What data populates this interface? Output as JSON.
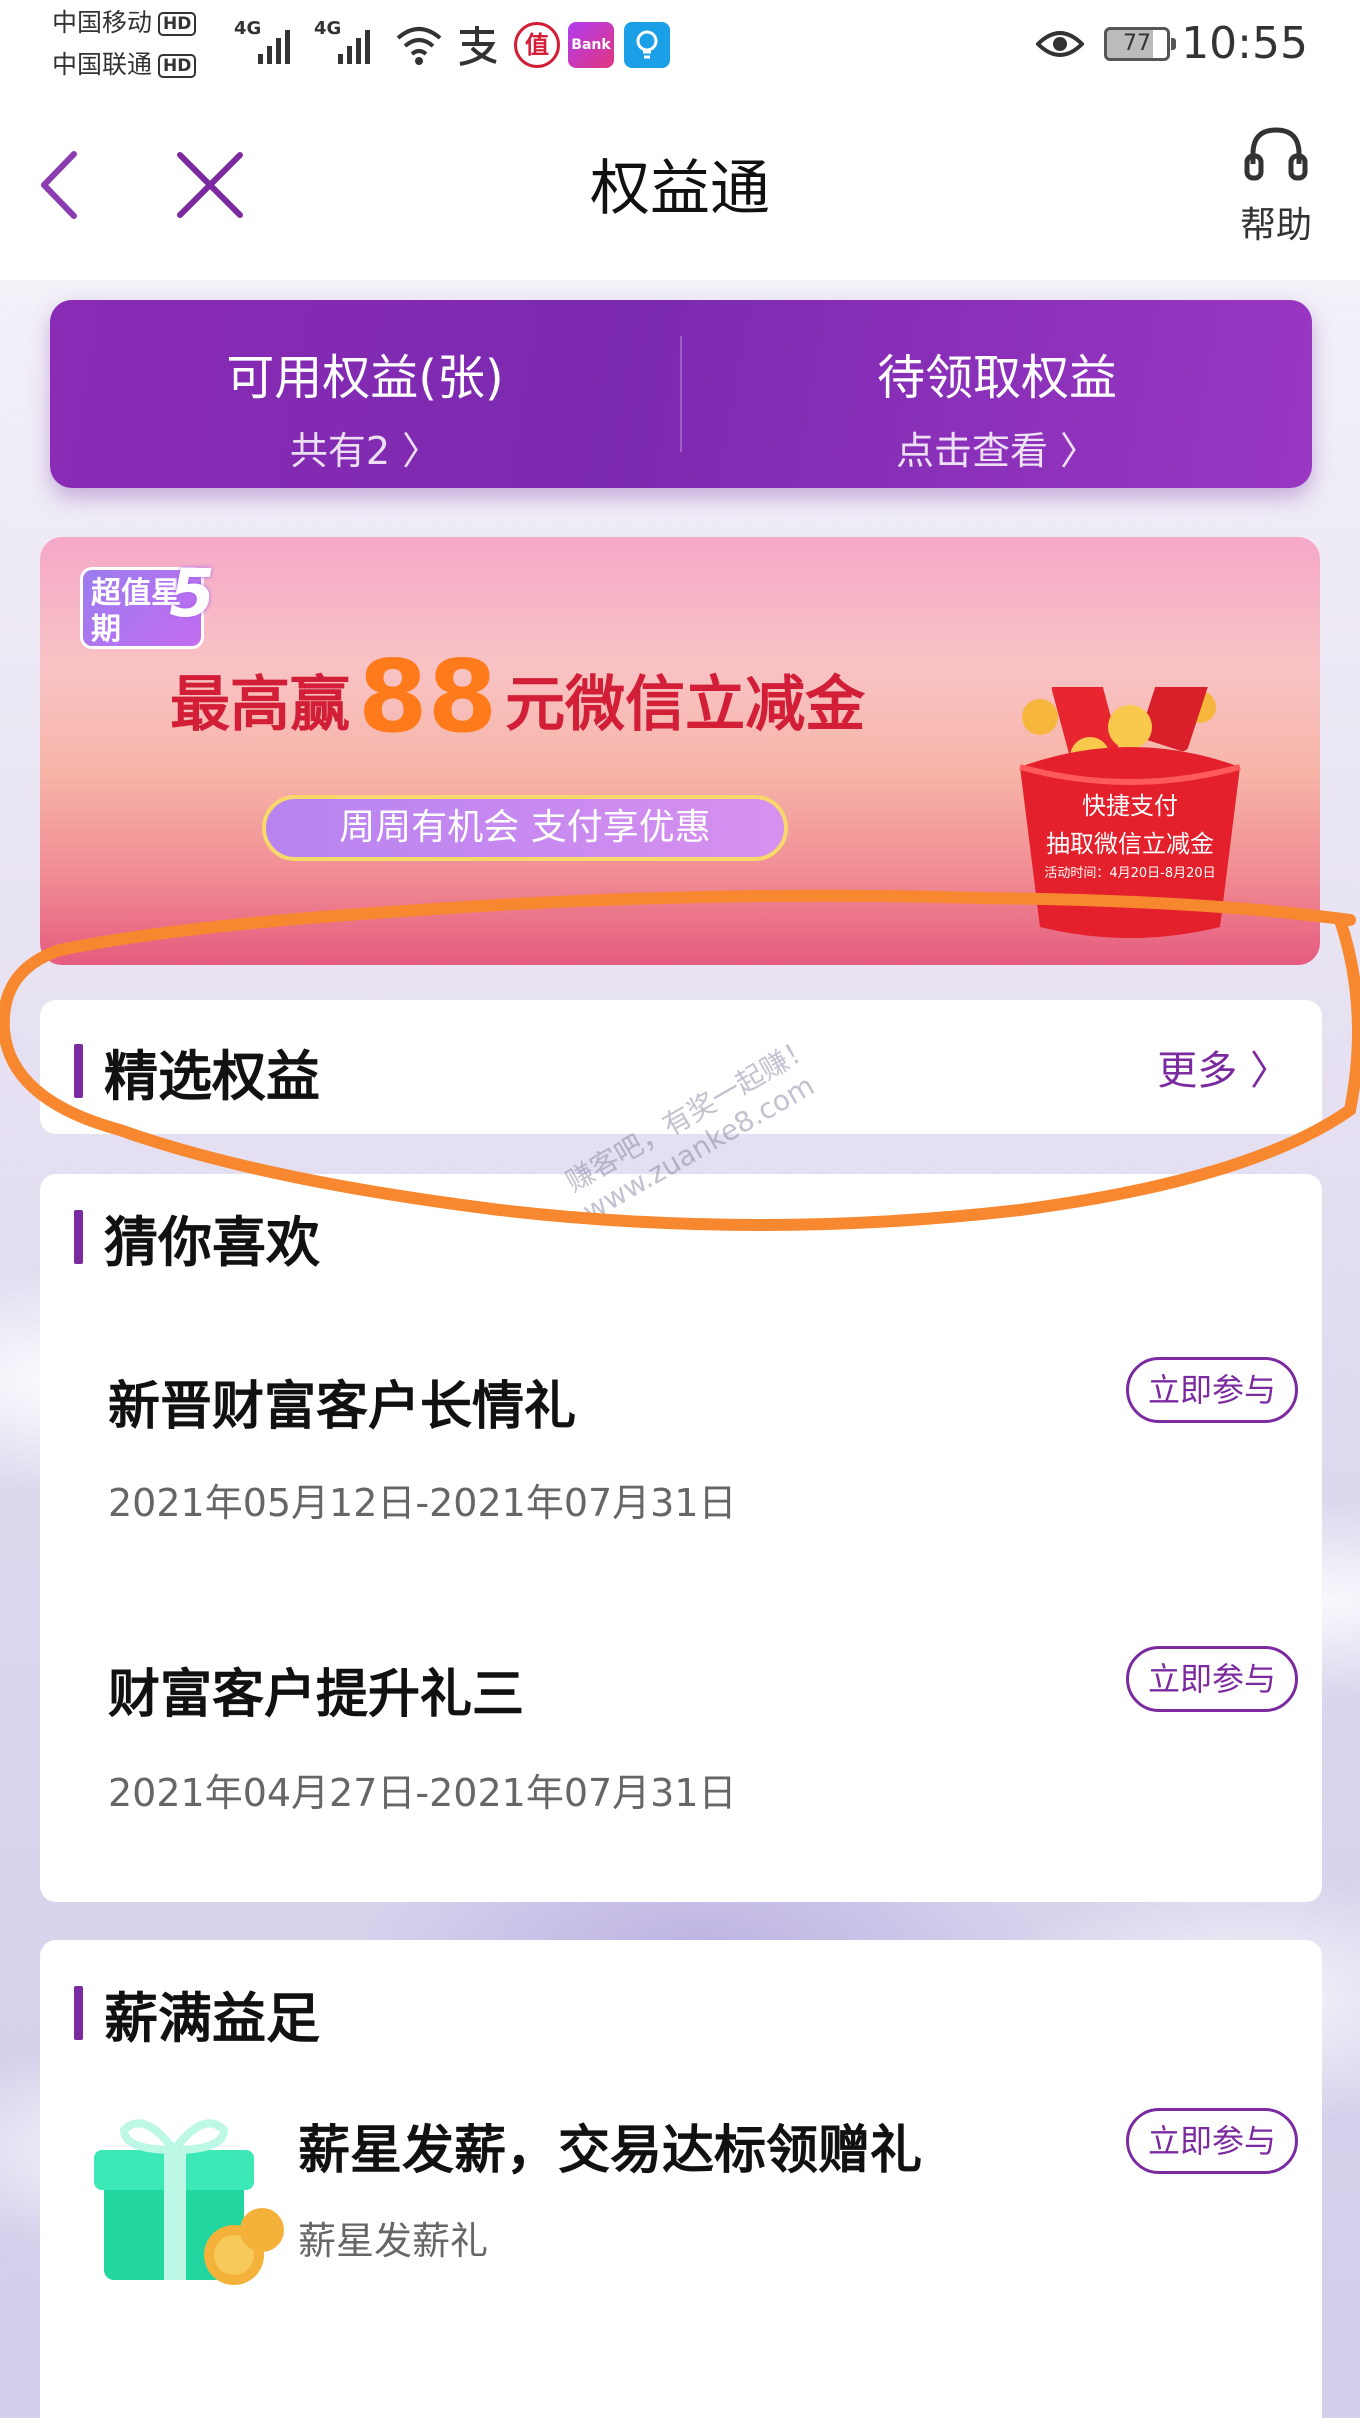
{
  "status_bar": {
    "carrier1": "中国移动",
    "carrier2": "中国联通",
    "hd_label": "HD",
    "network1": "4G",
    "network2": "4G",
    "battery": "77",
    "time": "10:55",
    "app_icons": [
      "wifi-icon",
      "alipay-icon",
      "zhi-icon",
      "bank-app-icon",
      "bulb-icon"
    ],
    "zhi_glyph": "值",
    "bank_label": "Bank"
  },
  "nav": {
    "title": "权益通",
    "help_label": "帮助"
  },
  "rights": {
    "available_label": "可用权益(张)",
    "available_sub": "共有2 〉",
    "pending_label": "待领取权益",
    "pending_sub": "点击查看 〉"
  },
  "banner": {
    "badge": "超值星期",
    "badge_num": "5",
    "headline_prefix": "最高赢",
    "amount": "88",
    "headline_suffix": "元微信立减金",
    "pill": "周周有机会 支付享优惠",
    "envelope_line1": "快捷支付",
    "envelope_line2": "抽取微信立减金",
    "envelope_small": "活动时间：4月20日-8月20日"
  },
  "featured": {
    "title": "精选权益",
    "more": "更多 〉"
  },
  "guess": {
    "title": "猜你喜欢",
    "items": [
      {
        "title": "新晋财富客户长情礼",
        "date": "2021年05月12日-2021年07月31日",
        "button": "立即参与"
      },
      {
        "title": "财富客户提升礼三",
        "date": "2021年04月27日-2021年07月31日",
        "button": "立即参与"
      }
    ]
  },
  "salary": {
    "title": "薪满益足",
    "item": {
      "title": "薪星发薪，交易达标领赠礼",
      "sub": "薪星发薪礼",
      "button": "立即参与"
    }
  },
  "watermark": {
    "line1": "赚客吧，有奖一起赚！",
    "line2": "www.zuanke8.com"
  },
  "colors": {
    "accent": "#7b2a9f",
    "card_gradient_start": "#8a2bb5",
    "annotation": "#f7882f"
  }
}
